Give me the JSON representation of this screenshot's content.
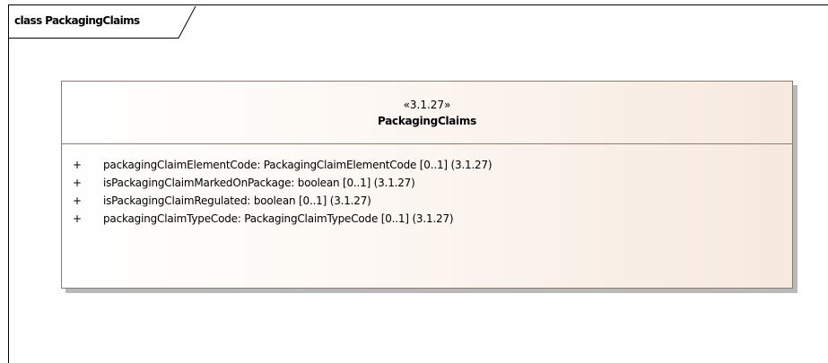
{
  "diagram": {
    "frame_label": "class PackagingClaims",
    "class": {
      "stereotype": "«3.1.27»",
      "name": "PackagingClaims",
      "attributes": [
        {
          "visibility": "+",
          "text": "packagingClaimElementCode: PackagingClaimElementCode [0..1] (3.1.27)"
        },
        {
          "visibility": "+",
          "text": "isPackagingClaimMarkedOnPackage: boolean [0..1] (3.1.27)"
        },
        {
          "visibility": "+",
          "text": "isPackagingClaimRegulated: boolean [0..1] (3.1.27)"
        },
        {
          "visibility": "+",
          "text": "packagingClaimTypeCode: PackagingClaimTypeCode [0..1] (3.1.27)"
        }
      ]
    }
  }
}
